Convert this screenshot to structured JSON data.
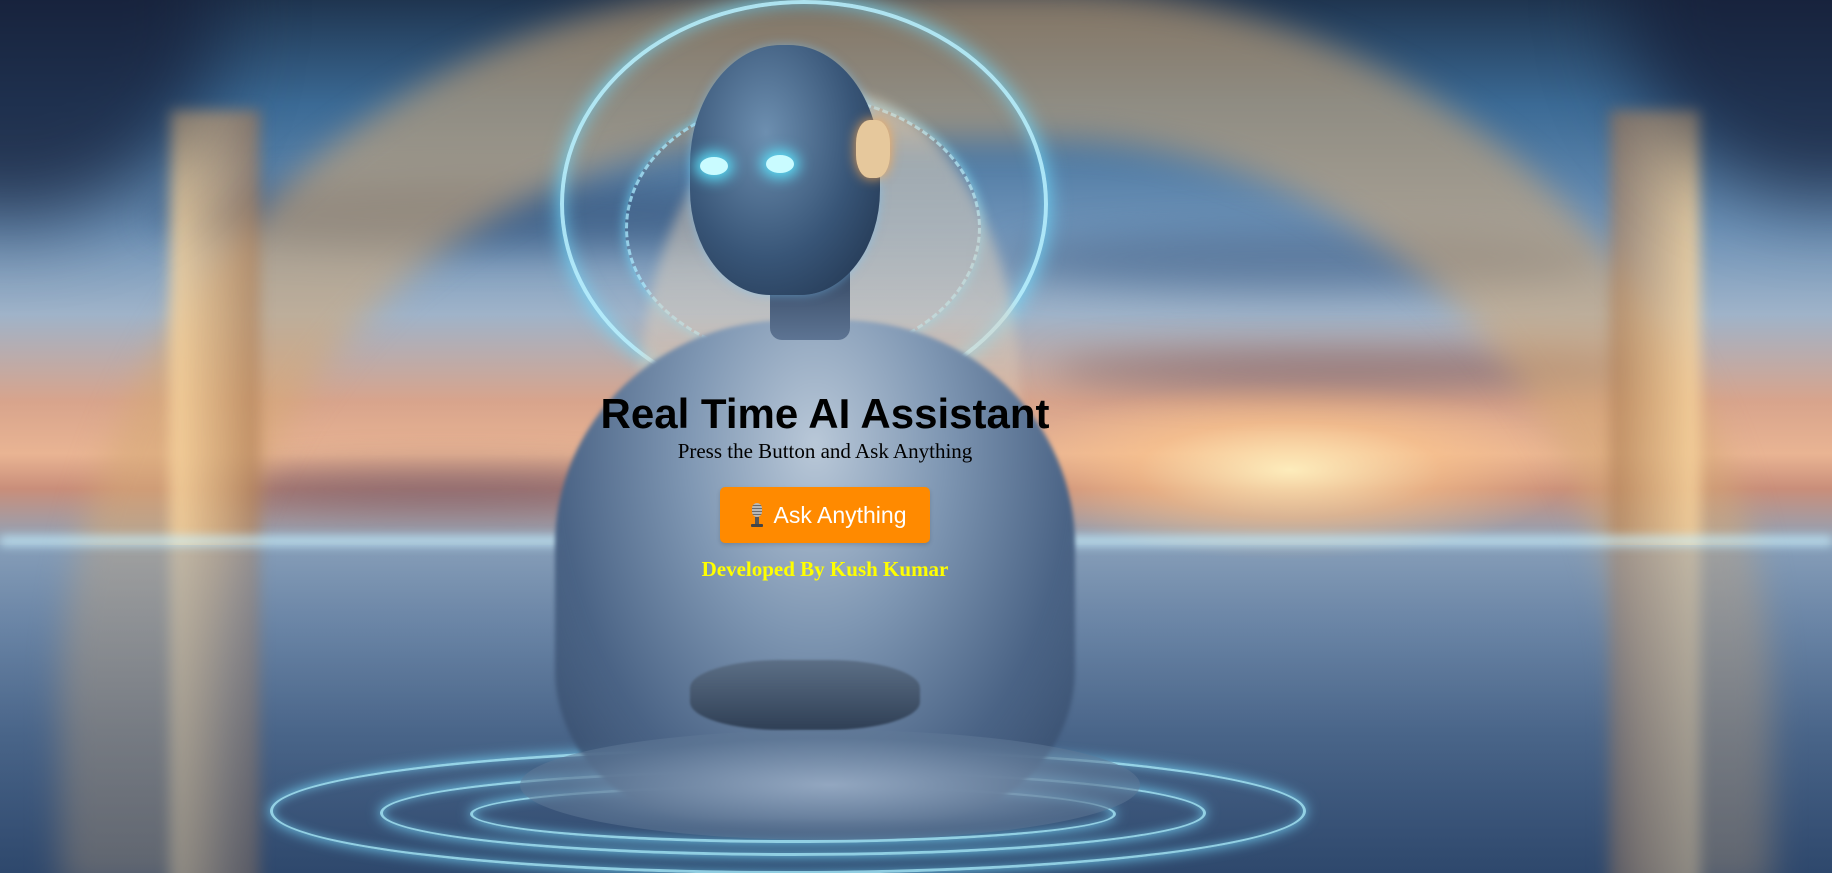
{
  "page": {
    "title": "Real Time AI Assistant",
    "subtitle": "Press the Button and Ask Anything",
    "credit": "Developed By Kush Kumar"
  },
  "actions": {
    "ask_button": {
      "label": "Ask Anything",
      "icon": "microphone-icon"
    }
  },
  "colors": {
    "button_background": "#ff8a00",
    "button_text": "#ffffff",
    "title_text": "#000000",
    "credit_text": "#ffff00"
  }
}
